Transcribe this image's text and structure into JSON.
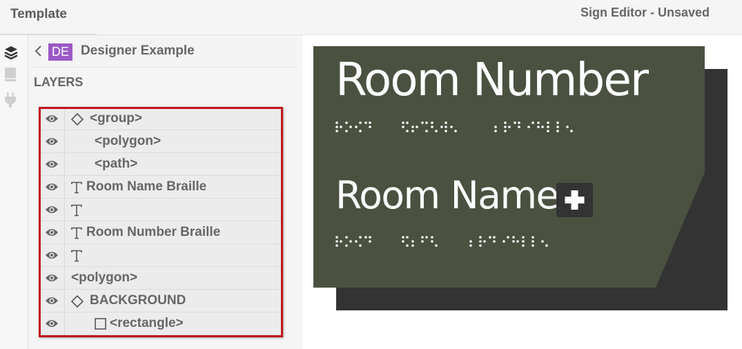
{
  "header": {
    "tab_label": "Template",
    "editor_title": "Sign Editor - Unsaved"
  },
  "rail": {
    "icons": [
      "layers-icon",
      "book-icon",
      "plug-icon"
    ]
  },
  "panel": {
    "badge": "DE",
    "project_name": "Designer Example",
    "section_title": "LAYERS",
    "layers": [
      {
        "label": "<group>",
        "icon": "diamond-icon"
      },
      {
        "label": "<polygon>",
        "icon": ""
      },
      {
        "label": "<path>",
        "icon": ""
      },
      {
        "label": "Room Name Braille",
        "icon": "text-icon"
      },
      {
        "label": "",
        "icon": "text-icon"
      },
      {
        "label": "Room Number Braille",
        "icon": "text-icon"
      },
      {
        "label": "",
        "icon": "text-icon"
      },
      {
        "label": "<polygon>",
        "icon": ""
      },
      {
        "label": "BACKGROUND",
        "icon": "diamond-icon"
      },
      {
        "label": "<rectangle>",
        "icon": "square-icon"
      }
    ]
  },
  "sign": {
    "room_number": "Room Number",
    "room_name": "Room Name",
    "colors": {
      "panel": "#4a5140",
      "shadow": "#333333",
      "text": "#ffffff",
      "highlight": "#c0121a",
      "badge": "#9b59c5"
    }
  }
}
